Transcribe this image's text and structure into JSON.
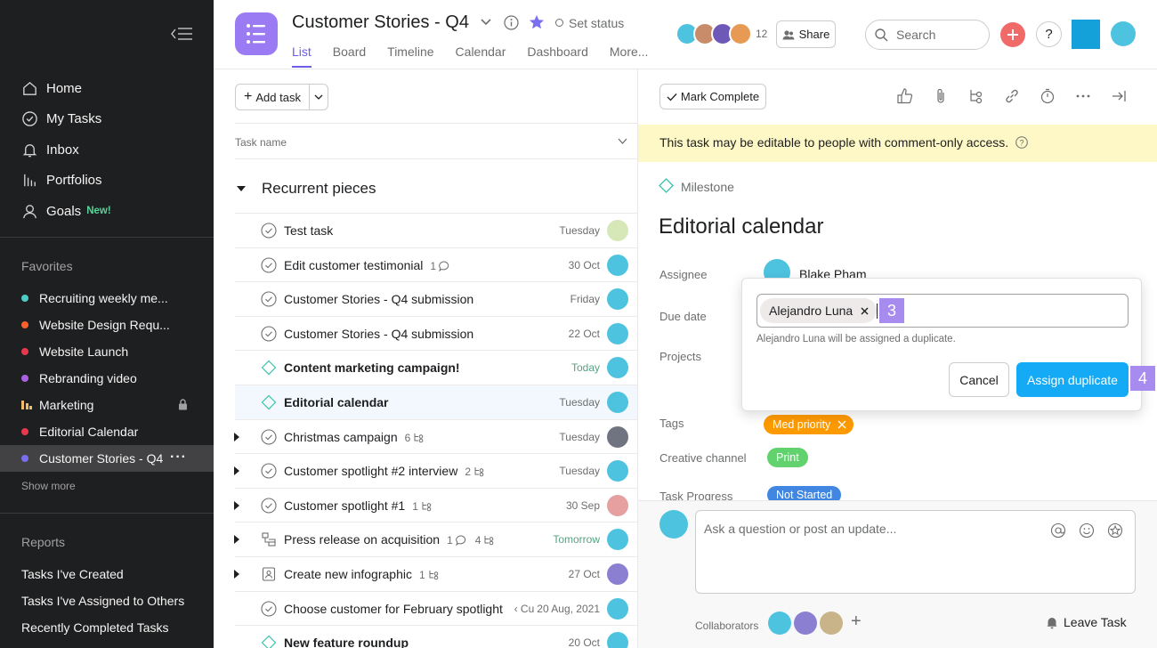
{
  "sidebar": {
    "nav": [
      {
        "label": "Home",
        "icon": "home-icon"
      },
      {
        "label": "My Tasks",
        "icon": "check-circle-icon"
      },
      {
        "label": "Inbox",
        "icon": "bell-icon"
      },
      {
        "label": "Portfolios",
        "icon": "bar-chart-icon"
      },
      {
        "label": "Goals",
        "icon": "person-icon",
        "badge": "New!"
      }
    ],
    "favorites_heading": "Favorites",
    "favorites": [
      {
        "label": "Recruiting weekly me...",
        "color": "#4ecbc4"
      },
      {
        "label": "Website Design Requ...",
        "color": "#fd612c"
      },
      {
        "label": "Website Launch",
        "color": "#e8384f"
      },
      {
        "label": "Rebranding video",
        "color": "#aa62e3"
      },
      {
        "label": "Marketing",
        "color": "#f1bd6c"
      },
      {
        "label": "Editorial Calendar",
        "color": "#e8384f"
      },
      {
        "label": "Customer Stories - Q4",
        "color": "#7a6ff0"
      }
    ],
    "show_more": "Show more",
    "reports_heading": "Reports",
    "reports": [
      "Tasks I've Created",
      "Tasks I've Assigned to Others",
      "Recently Completed Tasks"
    ]
  },
  "header": {
    "title": "Customer Stories - Q4",
    "set_status": "Set status",
    "tabs": [
      "List",
      "Board",
      "Timeline",
      "Calendar",
      "Dashboard",
      "More..."
    ],
    "members_count": "12",
    "share": "Share",
    "search_placeholder": "Search",
    "help": "?"
  },
  "list": {
    "add_task": "Add task",
    "column_task_name": "Task name",
    "section_title": "Recurrent pieces",
    "rows": [
      {
        "name": "Test task",
        "due": "Tuesday",
        "kind": "task",
        "expand": false,
        "meta": ""
      },
      {
        "name": "Edit customer testimonial",
        "due": "30 Oct",
        "kind": "task",
        "expand": false,
        "meta": "1",
        "meta_icon": "comment-icon"
      },
      {
        "name": "Customer Stories - Q4 submission",
        "due": "Friday",
        "kind": "task",
        "expand": false,
        "meta": ""
      },
      {
        "name": "Customer Stories - Q4 submission",
        "due": "22 Oct",
        "kind": "task",
        "expand": false,
        "meta": ""
      },
      {
        "name": "Content  marketing campaign!",
        "due": "Today",
        "kind": "milestone",
        "expand": false,
        "meta": "",
        "bold": true,
        "due_green": true
      },
      {
        "name": "Editorial calendar",
        "due": "Tuesday",
        "kind": "milestone",
        "expand": false,
        "meta": "",
        "bold": true,
        "selected": true
      },
      {
        "name": "Christmas campaign",
        "due": "Tuesday",
        "kind": "task",
        "expand": true,
        "meta": "6",
        "meta_icon": "subtask-icon"
      },
      {
        "name": "Customer spotlight #2 interview",
        "due": "Tuesday",
        "kind": "task",
        "expand": true,
        "meta": "2",
        "meta_icon": "subtask-icon"
      },
      {
        "name": "Customer spotlight #1",
        "due": "30 Sep",
        "kind": "task",
        "expand": true,
        "meta": "1",
        "meta_icon": "subtask-icon"
      },
      {
        "name": "Press release on acquisition",
        "due": "Tomorrow",
        "kind": "approval",
        "expand": true,
        "meta": "1",
        "meta_icon": "comment-icon",
        "meta2": "4",
        "due_green": true
      },
      {
        "name": "Create new infographic",
        "due": "27 Oct",
        "kind": "doc",
        "expand": true,
        "meta": "1",
        "meta_icon": "subtask-icon"
      },
      {
        "name": "Choose customer for February spotlight",
        "due": "20 Aug, 2021",
        "due_prefix": "‹ Cu",
        "kind": "task",
        "expand": false,
        "meta": ""
      },
      {
        "name": "New feature roundup",
        "due": "20 Oct",
        "kind": "milestone",
        "expand": false,
        "meta": "",
        "bold": true
      }
    ]
  },
  "detail": {
    "mark_complete": "Mark Complete",
    "banner": "This task may be editable to people with comment-only access.",
    "type_label": "Milestone",
    "title": "Editorial calendar",
    "fields": {
      "assignee_label": "Assignee",
      "assignee_value": "Blake Pham",
      "due_label": "Due date",
      "projects_label": "Projects",
      "tags_label": "Tags",
      "tag_value": "Med priority",
      "channel_label": "Creative channel",
      "channel_value": "Print",
      "progress_label": "Task Progress",
      "progress_value": "Not Started"
    },
    "comment_placeholder": "Ask a question or post an update...",
    "collaborators_label": "Collaborators",
    "leave_task": "Leave Task"
  },
  "popup": {
    "chip": "Alejandro Luna",
    "hint": "Alejandro Luna will be assigned a duplicate.",
    "cancel": "Cancel",
    "assign": "Assign duplicate",
    "step_a": "3",
    "step_b": "4"
  },
  "colors": {
    "accent": "#6c5ee8",
    "primary_button": "#14aaf5",
    "milestone": "#37c5ab",
    "tag_orange": "#fd9a00",
    "channel_green": "#62d26f",
    "progress_blue": "#4186e0"
  }
}
